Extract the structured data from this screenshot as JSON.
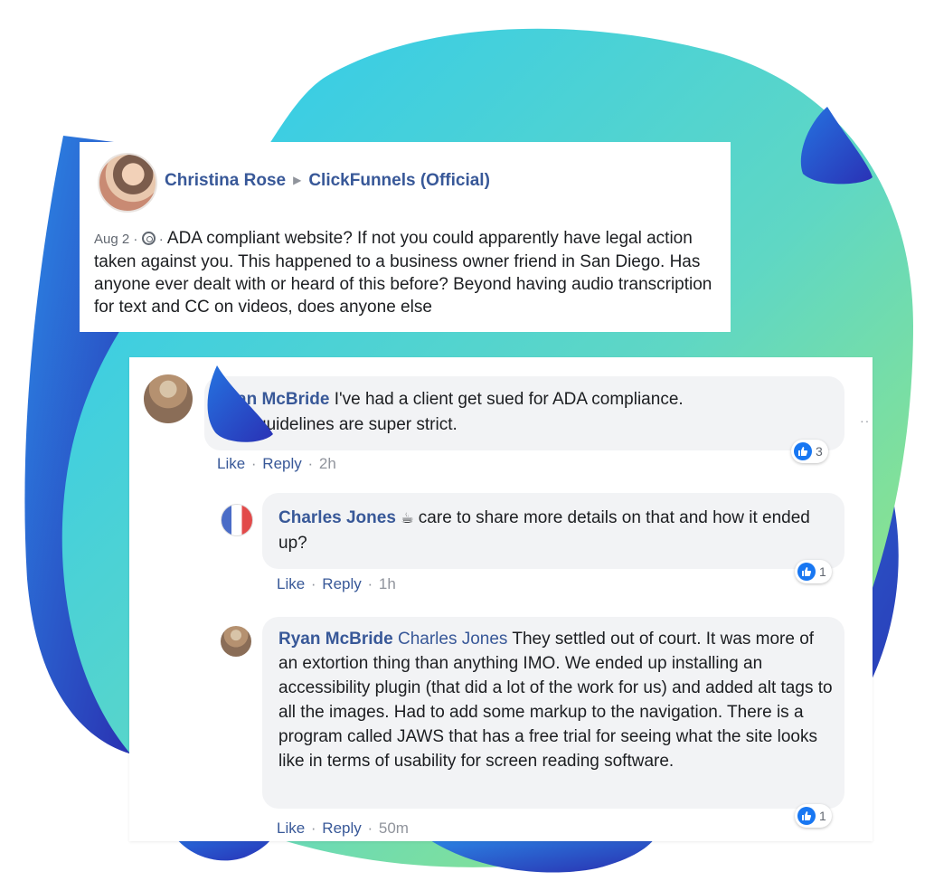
{
  "post": {
    "author": "Christina Rose",
    "group": "ClickFunnels (Official)",
    "date": "Aug 2",
    "sep": " · ",
    "text": "ADA compliant website? If not you could apparently have legal action taken against you. This happened to a business owner friend in San Diego. Has anyone ever dealt with or heard of this before? Beyond having audio transcription for text and CC on videos, does anyone else"
  },
  "comments": [
    {
      "author": "Ryan McBride",
      "author_visible": "an McBride",
      "text_line1": " I've had a client get sued for ADA compliance.",
      "text_line2": "guidelines are super strict.",
      "like": "Like",
      "reply": "Reply",
      "time": "2h",
      "reactions": "3"
    },
    {
      "author": "Charles Jones",
      "emoji": "☕",
      "text": " care to share more details on that and how it ended up?",
      "like": "Like",
      "reply": "Reply",
      "time": "1h",
      "reactions": "1"
    },
    {
      "author": "Ryan McBride",
      "mention": "Charles Jones",
      "text": " They settled out of court. It was more of an extortion thing than anything IMO. We ended up installing an accessibility plugin (that did a lot of the work for us) and added alt tags to all the images. Had to add some markup to the navigation. There is a program called JAWS that has a free trial for seeing what the site looks like in terms of usability for screen reading software.",
      "like": "Like",
      "reply": "Reply",
      "time": "50m",
      "reactions": "1"
    }
  ],
  "more_options": "··",
  "colors": {
    "link_blue": "#385898",
    "like_blue": "#1877f2",
    "bubble_bg": "#f2f3f5",
    "blob_cyan": "#29c6ef",
    "blob_green": "#9fe870",
    "blob_navy": "#2c3fb8"
  },
  "icons": [
    "globe-icon",
    "thumbs-up-icon",
    "arrow-right-icon",
    "coffee-icon"
  ]
}
